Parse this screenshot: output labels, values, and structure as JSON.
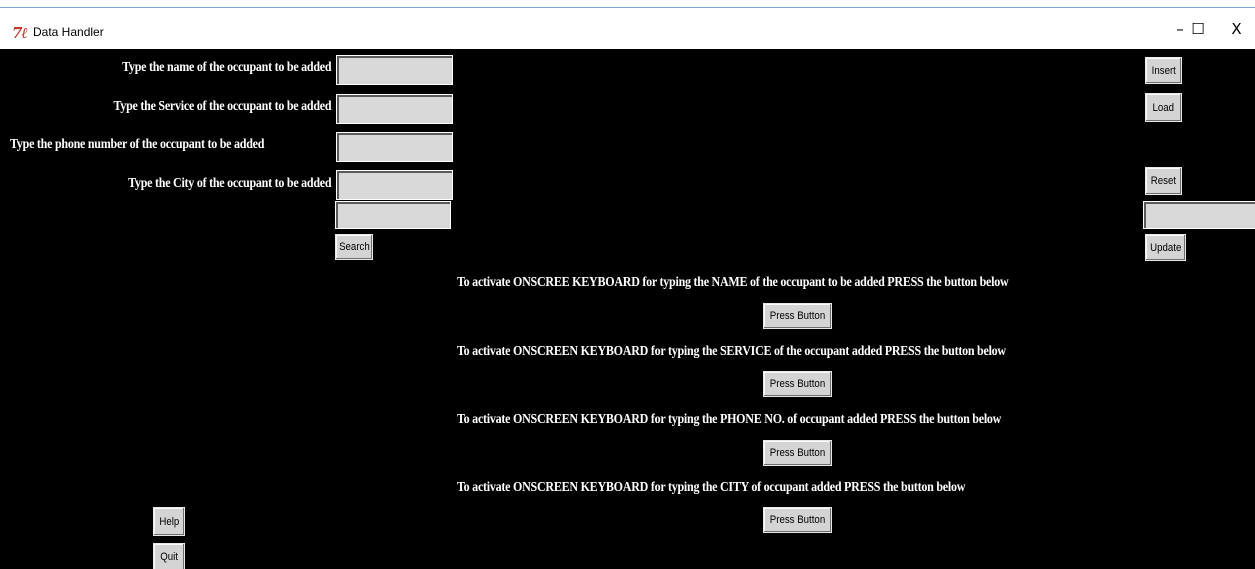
{
  "window": {
    "title": "Data Handler",
    "minimize_glyph": "–",
    "maximize_glyph": "☐",
    "close_glyph": "X"
  },
  "form": {
    "name_label": "Type the name of the occupant to be added",
    "service_label": "Type the Service of the occupant  to be added",
    "phone_label": "Type the phone number of the occupant to be added",
    "city_label": "Type the City of the occupant  to be added",
    "name_value": "",
    "service_value": "",
    "phone_value": "",
    "city_value": "",
    "search_value": "",
    "update_value": ""
  },
  "buttons": {
    "insert": "Insert",
    "load": "Load",
    "reset": "Reset",
    "search": "Search",
    "update": "Update",
    "help": "Help",
    "quit": "Quit"
  },
  "keyboard": {
    "name_prompt": "To activate ONSCREE KEYBOARD for typing the NAME of the occupant to be added PRESS the button below",
    "service_prompt": "To activate ONSCREEN KEYBOARD for typing the SERVICE of the occupant added PRESS the button below",
    "phone_prompt": "To activate ONSCREEN KEYBOARD for typing the PHONE NO. of occupant added PRESS the button below",
    "city_prompt": "To activate ONSCREEN KEYBOARD for typing the CITY of occupant added PRESS the button below",
    "press_label": "Press Button"
  },
  "colors": {
    "background": "#000000",
    "entry": "#d9d9d9",
    "button": "#d4d4d4",
    "icon": "#c0392b"
  },
  "icons": {
    "app": "feather-icon"
  }
}
